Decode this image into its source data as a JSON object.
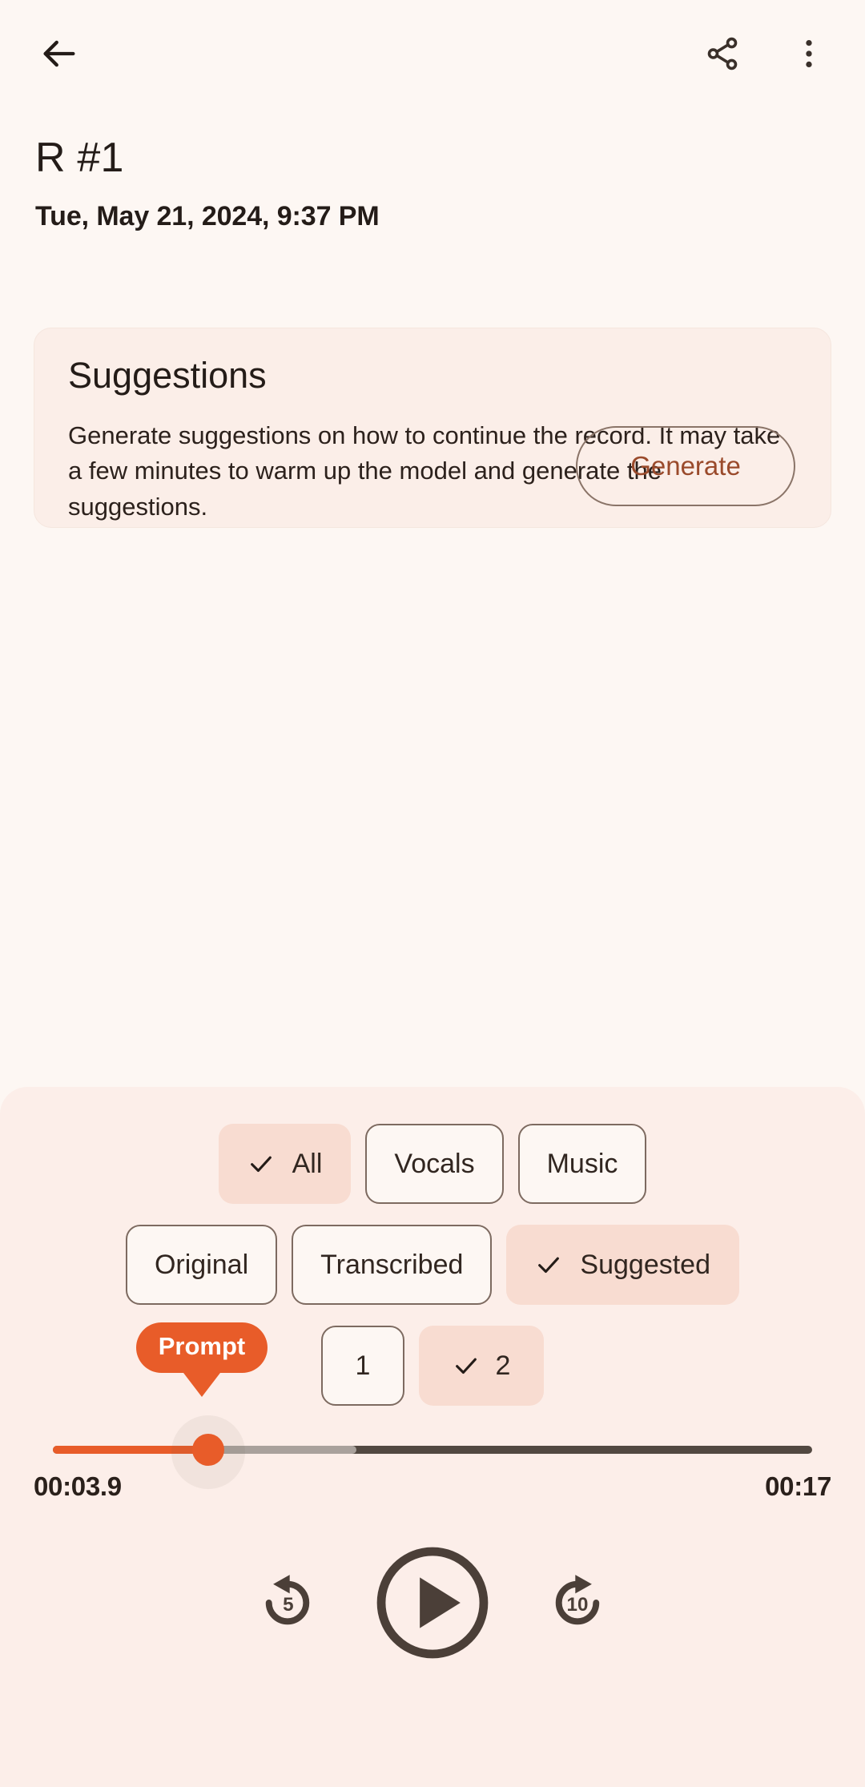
{
  "appbar": {
    "back_icon": "arrow-left-icon",
    "share_icon": "share-icon",
    "overflow_icon": "more-vertical-icon"
  },
  "header": {
    "title": "R #1",
    "date": "Tue, May 21, 2024, 9:37 PM"
  },
  "suggestions_card": {
    "title": "Suggestions",
    "body": "Generate suggestions on how to continue the record. It may take a few minutes to warm up the model and generate the suggestions.",
    "generate_label": "Generate"
  },
  "player": {
    "filters_track": [
      {
        "label": "All",
        "selected": true
      },
      {
        "label": "Vocals",
        "selected": false
      },
      {
        "label": "Music",
        "selected": false
      }
    ],
    "filters_source": [
      {
        "label": "Original",
        "selected": false
      },
      {
        "label": "Transcribed",
        "selected": false
      },
      {
        "label": "Suggested",
        "selected": true
      }
    ],
    "filters_index": [
      {
        "label": "1",
        "selected": false
      },
      {
        "label": "2",
        "selected": true
      }
    ],
    "prompt_marker": {
      "label": "Prompt",
      "color": "#e85c29",
      "position_percent": 20.5
    },
    "seek": {
      "played_percent": 20.5,
      "buffered_percent": 40,
      "played_color": "#e85c29",
      "buffer_color": "#a9a19c",
      "track_color": "#524841"
    },
    "current_time": "00:03.9",
    "total_time": "00:17",
    "controls": [
      {
        "name": "replay-5-icon",
        "label": "5"
      },
      {
        "name": "play-icon",
        "label": ""
      },
      {
        "name": "forward-10-icon",
        "label": "10"
      }
    ]
  },
  "colors": {
    "page_bg": "#fdf7f3",
    "panel_bg": "#fceee9",
    "card_bg": "#fbeee8",
    "accent": "#e85c29",
    "chip_selected_bg": "#f8dcd1",
    "text": "#241c18",
    "generate_text": "#9a4a2b"
  }
}
